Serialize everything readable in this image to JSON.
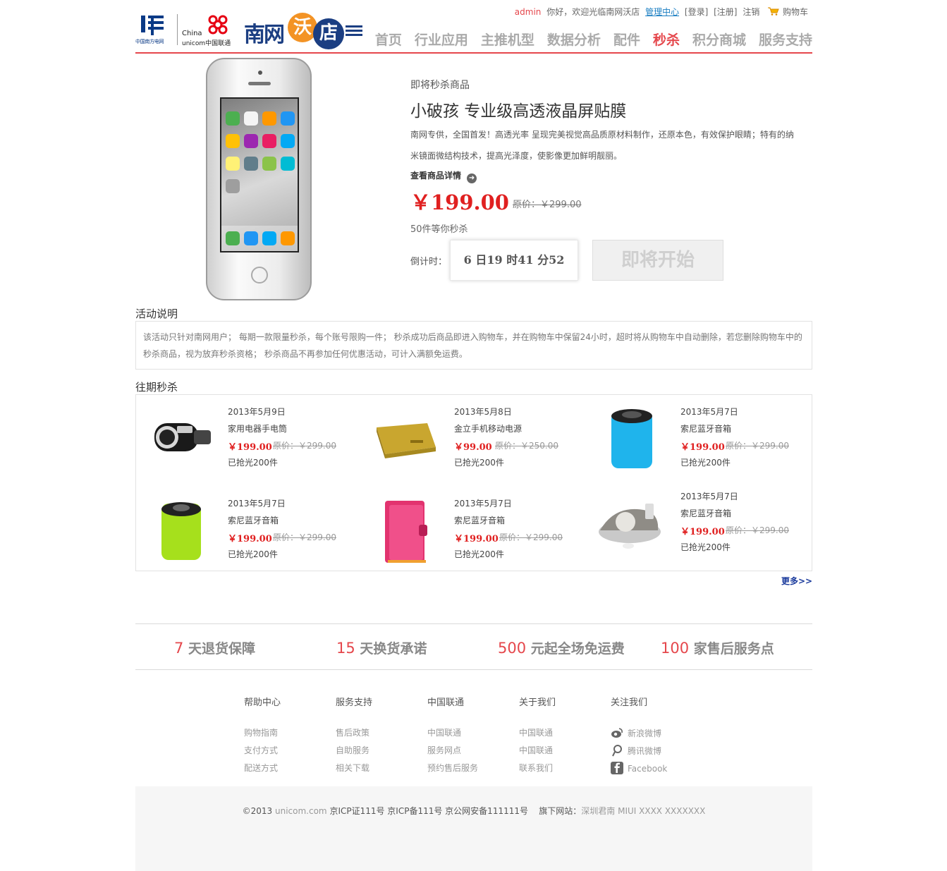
{
  "header": {
    "logos": {
      "csg_caption": "中国南方电网",
      "unicom_line1": "China",
      "unicom_line2": "unicom中国联通",
      "store_name": "南网",
      "store_badge1": "沃",
      "store_badge2": "店"
    },
    "topbar": {
      "user": "admin",
      "greeting": "你好，欢迎光临南网沃店",
      "admin_center": "管理中心",
      "login": "[登录]",
      "register": "[注册]",
      "logout": "注销",
      "cart": "购物车"
    },
    "nav": [
      "首页",
      "行业应用",
      "主推机型",
      "数据分析",
      "配件",
      "秒杀",
      "积分商城",
      "服务支持"
    ],
    "nav_active_index": 5
  },
  "product": {
    "status": "即将秒杀商品",
    "title": "小破孩 专业级高透液晶屏贴膜",
    "description": "南网专供，全国首发！高透光率 呈现完美视觉高品质原材料制作，还原本色，有效保护眼睛；特有的纳米镜面微结构技术，提高光泽度，使影像更加鲜明靓丽。",
    "detail_link": "查看商品详情",
    "price": "￥199.00",
    "original_price": "原价：￥299.00",
    "stock": "50件等你秒杀",
    "countdown_label": "倒计时：",
    "countdown": {
      "days": "6",
      "d_unit": "日",
      "hours": "19",
      "h_unit": "时",
      "minutes": "41",
      "m_unit": "分",
      "seconds": "52"
    },
    "start_button": "即将开始"
  },
  "rules": {
    "title": "活动说明",
    "text": "该活动只针对南网用户；  每期一款限量秒杀，每个账号限购一件；  秒杀成功后商品即进入购物车，并在购物车中保留24小时，超时将从购物车中自动删除，若您删除购物车中的秒杀商品，视为放弃秒杀资格；  秒杀商品不再参加任何优惠活动，可计入满额免运费。"
  },
  "past": {
    "title": "往期秒杀",
    "more": "更多>>",
    "items": [
      {
        "date": "2013年5月9日",
        "name": "家用电器手电筒",
        "price": "￥199.00",
        "old": "原价：￥299.00",
        "sold": "已抢光200件",
        "thumb": "car-charger"
      },
      {
        "date": "2013年5月8日",
        "name": "金立手机移动电源",
        "price": "￥99.00",
        "old": "原价：￥250.00",
        "sold": "已抢光200件",
        "thumb": "power-bank"
      },
      {
        "date": "2013年5月7日",
        "name": "索尼蓝牙音箱",
        "price": "￥199.00",
        "old": "原价：￥299.00",
        "sold": "已抢光200件",
        "thumb": "blue-speaker"
      },
      {
        "date": "2013年5月7日",
        "name": "索尼蓝牙音箱",
        "price": "￥199.00",
        "old": "原价：￥299.00",
        "sold": "已抢光200件",
        "thumb": "green-speaker"
      },
      {
        "date": "2013年5月7日",
        "name": "索尼蓝牙音箱",
        "price": "￥199.00",
        "old": "原价：￥299.00",
        "sold": "已抢光200件",
        "thumb": "pink-case"
      },
      {
        "date": "2013年5月7日",
        "name": "索尼蓝牙音箱",
        "price": "￥199.00",
        "old": "原价：￥299.00",
        "sold": "已抢光200件",
        "thumb": "dock-speaker"
      }
    ]
  },
  "guarantees": [
    {
      "num": "7",
      "text": " 天退货保障"
    },
    {
      "num": "15",
      "text": " 天换货承诺"
    },
    {
      "num": "500",
      "text": " 元起全场免运费"
    },
    {
      "num": "100",
      "text": " 家售后服务点"
    }
  ],
  "footer": {
    "columns": [
      {
        "title": "帮助中心",
        "links": [
          "购物指南",
          "支付方式",
          "配送方式"
        ]
      },
      {
        "title": "服务支持",
        "links": [
          "售后政策",
          "自助服务",
          "相关下载"
        ]
      },
      {
        "title": "中国联通",
        "links": [
          "中国联通",
          "服务网点",
          "预约售后服务"
        ]
      },
      {
        "title": "关于我们",
        "links": [
          "中国联通",
          "中国联通",
          "联系我们"
        ]
      },
      {
        "title": "关注我们",
        "links": [
          "新浪微博",
          "腾讯微博",
          "Facebook"
        ]
      }
    ],
    "copyright_prefix": "©2013",
    "copyright_domain": "unicom.com",
    "copyright_icp": "京ICP证111号 京ICP备111号 京公网安备111111号",
    "copyright_sites_label": "旗下网站：",
    "copyright_sites": "深圳君南 MIUI XXXX XXXXXXX"
  },
  "colors": {
    "accent": "#e5474c",
    "price": "#e02020",
    "brand_blue": "#1b3e82",
    "brand_orange": "#f39325"
  }
}
